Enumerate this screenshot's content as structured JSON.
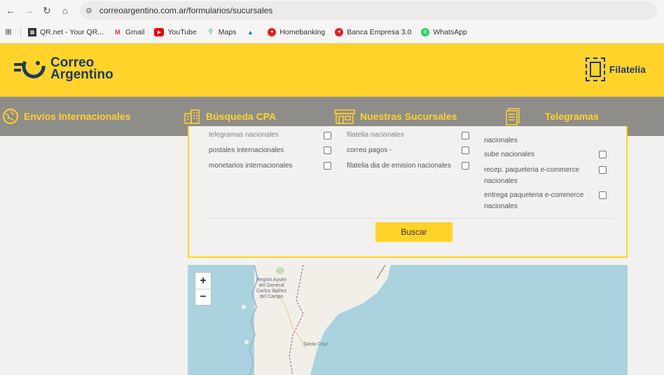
{
  "browser": {
    "url": "correoargentino.com.ar/formularios/sucursales",
    "bookmarks": [
      {
        "label": "QR.net - Your QR...",
        "icon": "qr-icon"
      },
      {
        "label": "Gmail",
        "icon": "gmail-icon"
      },
      {
        "label": "YouTube",
        "icon": "youtube-icon"
      },
      {
        "label": "Maps",
        "icon": "maps-icon"
      },
      {
        "label": "",
        "icon": "drive-icon"
      },
      {
        "label": "Homebanking",
        "icon": "bank-icon"
      },
      {
        "label": "Banca Empresa 3.0",
        "icon": "bank-icon"
      },
      {
        "label": "WhatsApp",
        "icon": "whatsapp-icon"
      }
    ]
  },
  "header": {
    "logo_line1": "Correo",
    "logo_line2": "Argentino",
    "filatelia": "Filatelia"
  },
  "nav": {
    "items": [
      {
        "label": "Envíos Internacionales",
        "icon": "globe-icon"
      },
      {
        "label": "Búsqueda CPA",
        "icon": "buildings-icon"
      },
      {
        "label": "Nuestras Sucursales",
        "icon": "store-icon"
      },
      {
        "label": "Telegramas",
        "icon": "document-icon"
      }
    ]
  },
  "form": {
    "col1": [
      "telegramas nacionales",
      "postales internacionales",
      "monetarios internacionales"
    ],
    "col2": [
      "filatelia nacionales",
      "correo pagos -",
      "filatelia dia de emision nacionales"
    ],
    "col3": [
      "nacionales",
      "sube nacionales",
      "recep. paqueteria e-commerce",
      "nacionales",
      "entrega paqueteria e-commerce",
      "nacionales"
    ],
    "search_button": "Buscar"
  },
  "map": {
    "zoom_in": "+",
    "zoom_out": "−",
    "labels": {
      "region": "Región Aysén del General Carlos Ibáñez del Campo",
      "region_l1": "Región Aysén",
      "region_l2": "del General",
      "region_l3": "Carlos Ibáñez",
      "region_l4": "del Campo",
      "province": "Santa Cruz"
    },
    "colors": {
      "water": "#aad3df",
      "land": "#f2efe9"
    }
  }
}
